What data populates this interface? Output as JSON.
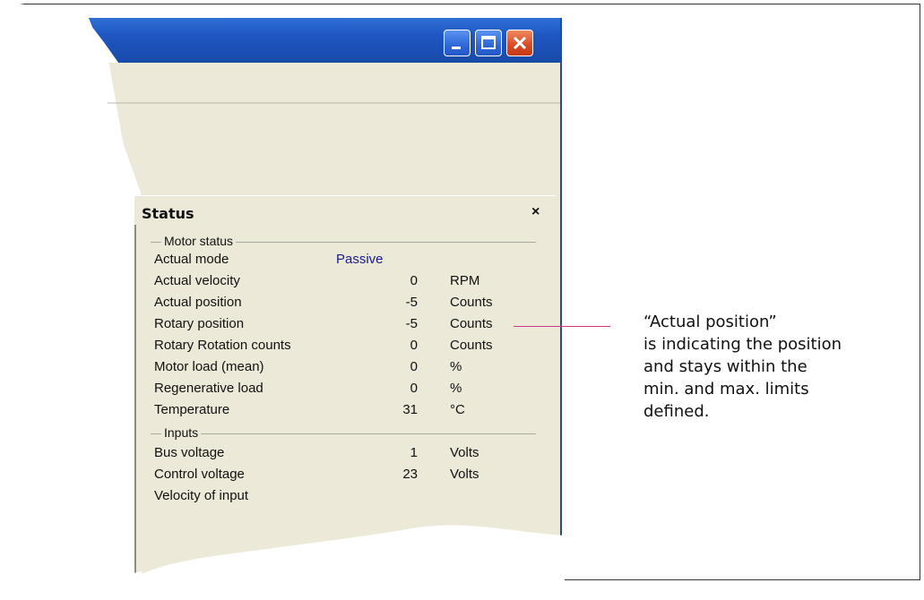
{
  "status_panel": {
    "title": "Status",
    "close_glyph": "×",
    "groups": {
      "motor_status": "Motor status",
      "inputs": "Inputs"
    },
    "rows": [
      {
        "label": "Actual mode",
        "value": "Passive",
        "unit": ""
      },
      {
        "label": "Actual velocity",
        "value": "0",
        "unit": "RPM"
      },
      {
        "label": "Actual position",
        "value": "-5",
        "unit": "Counts"
      },
      {
        "label": "Rotary position",
        "value": "-5",
        "unit": "Counts"
      },
      {
        "label": "Rotary Rotation counts",
        "value": "0",
        "unit": "Counts"
      },
      {
        "label": "Motor load (mean)",
        "value": "0",
        "unit": "%"
      },
      {
        "label": "Regenerative load",
        "value": "0",
        "unit": "%"
      },
      {
        "label": "Temperature",
        "value": "31",
        "unit": "°C"
      }
    ],
    "input_rows": [
      {
        "label": "Bus voltage",
        "value": "1",
        "unit": "Volts"
      },
      {
        "label": "Control voltage",
        "value": "23",
        "unit": "Volts"
      },
      {
        "label": "Velocity of input",
        "value": "",
        "unit": ""
      }
    ]
  },
  "callout": {
    "lines": [
      "“Actual position”",
      "is indicating the position",
      "and stays within the",
      "min. and max. limits",
      "defined."
    ],
    "color": "#d0398a"
  },
  "window": {
    "title_bar_color": "#1f56c2",
    "client_color": "#ece9d8"
  }
}
